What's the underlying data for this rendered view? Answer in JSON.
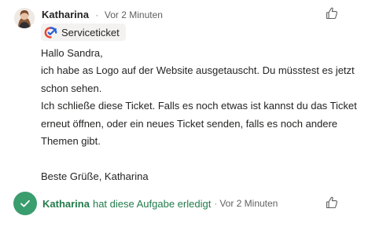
{
  "comment": {
    "author": "Katharina",
    "separator": "·",
    "time": "Vor 2 Minuten",
    "tag": {
      "label": "Serviceticket",
      "icon": "serviceticket-icon"
    },
    "body": [
      "Hallo Sandra,",
      "ich habe as Logo auf der Website ausgetauscht. Du müsstest es jetzt schon sehen.",
      "Ich schließe diese Ticket. Falls es noch etwas ist kannst du das Ticket erneut öffnen, oder ein neues Ticket senden, falls es noch andere Themen gibt.",
      "",
      "Beste Grüße, Katharina"
    ],
    "like_icon": "thumbs-up-icon"
  },
  "completion": {
    "author": "Katharina",
    "action": "hat diese Aufgabe erledigt",
    "separator": "·",
    "time": "Vor 2 Minuten",
    "icon": "checkmark-icon",
    "like_icon": "thumbs-up-icon"
  },
  "colors": {
    "completion_green": "#237b4b",
    "check_circle": "#3a9d6e",
    "chip_background": "#f3f2f1"
  }
}
